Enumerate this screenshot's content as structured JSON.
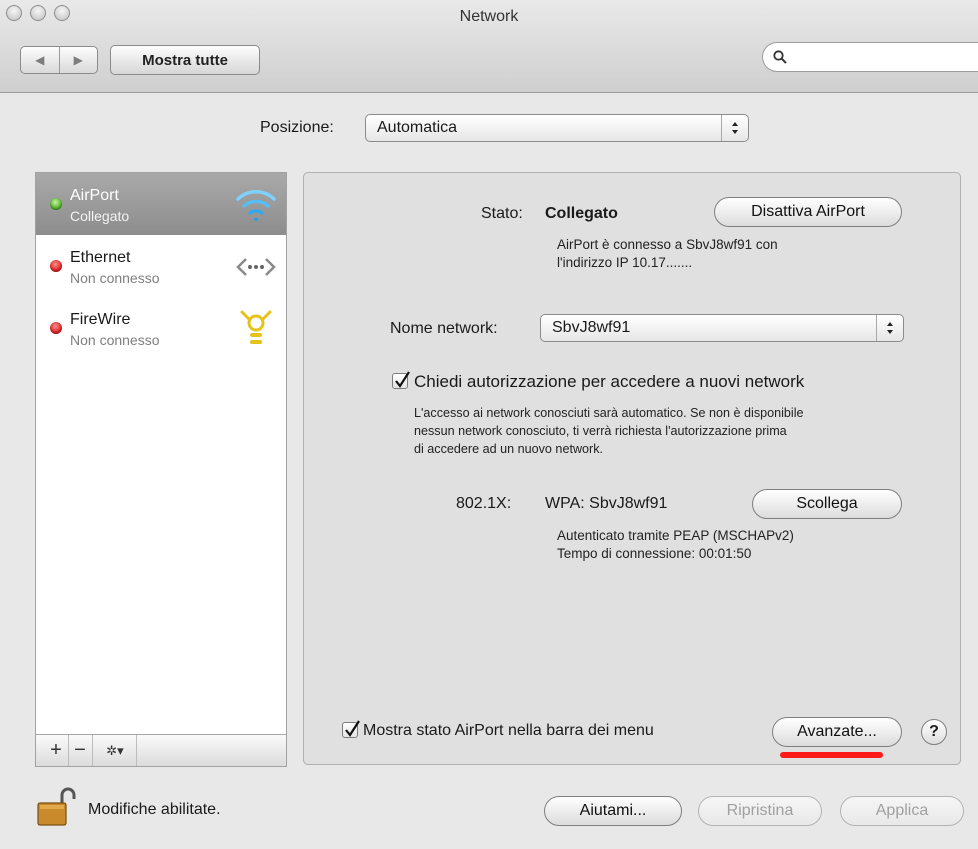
{
  "window": {
    "title": "Network"
  },
  "toolbar": {
    "back": "◀",
    "forward": "▶",
    "show_all": "Mostra tutte",
    "search_value": "",
    "search_placeholder": ""
  },
  "location": {
    "label": "Posizione:",
    "value": "Automatica"
  },
  "services": [
    {
      "name": "AirPort",
      "status": "Collegato",
      "status_color": "green",
      "icon": "wifi-icon",
      "selected": true
    },
    {
      "name": "Ethernet",
      "status": "Non connesso",
      "status_color": "red",
      "icon": "ethernet-icon",
      "selected": false
    },
    {
      "name": "FireWire",
      "status": "Non connesso",
      "status_color": "red",
      "icon": "firewire-icon",
      "selected": false
    }
  ],
  "sidebar_bar": {
    "add": "+",
    "remove": "−",
    "gear": "✲▾"
  },
  "status": {
    "label": "Stato:",
    "value": "Collegato",
    "toggle_button": "Disattiva AirPort",
    "description_1": "AirPort è connesso a SbvJ8wf91 con",
    "description_2": "l'indirizzo IP 10.17......."
  },
  "network_name": {
    "label": "Nome network:",
    "value": "SbvJ8wf91"
  },
  "ask_join": {
    "checked": true,
    "label": "Chiedi autorizzazione per accedere a nuovi network",
    "description_1": "L'accesso ai network conosciuti sarà automatico. Se non è disponibile",
    "description_2": "nessun network conosciuto, ti verrà richiesta l'autorizzazione prima",
    "description_3": "di accedere ad un nuovo network."
  },
  "dot1x": {
    "label": "802.1X:",
    "value": "WPA: SbvJ8wf91",
    "button": "Scollega",
    "detail_1": "Autenticato tramite PEAP (MSCHAPv2)",
    "detail_2": "Tempo di connessione: 00:01:50"
  },
  "menubar_status": {
    "checked": true,
    "label": "Mostra stato AirPort nella barra dei menu"
  },
  "advanced_button": "Avanzate...",
  "help": "?",
  "lock": {
    "label": "Modifiche abilitate."
  },
  "footer": {
    "assist": "Aiutami...",
    "revert": "Ripristina",
    "apply": "Applica"
  },
  "colors": {
    "highlight_underline": "#ff1a1a",
    "status_green": "#3fa71b",
    "status_red": "#d51515"
  }
}
